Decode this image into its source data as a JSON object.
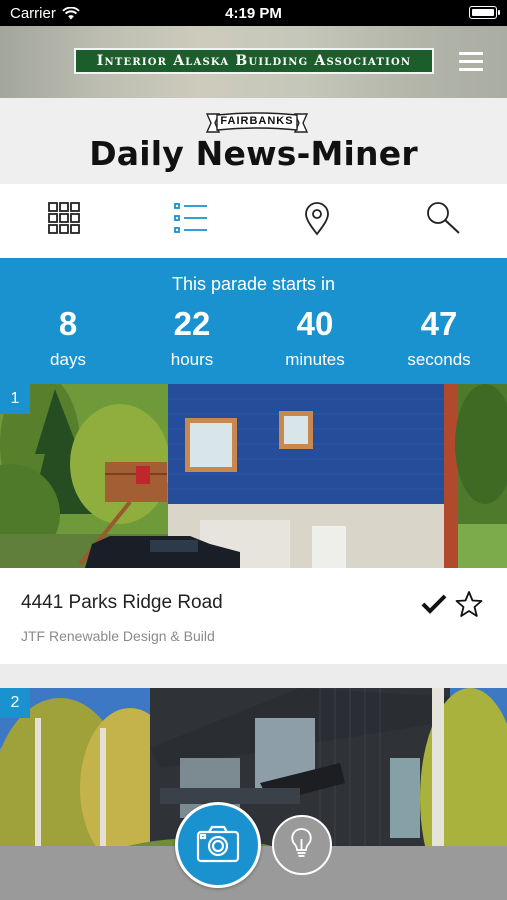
{
  "status_bar": {
    "carrier": "Carrier",
    "time": "4:19 PM"
  },
  "sponsor": {
    "name": "Interior Alaska Building Association",
    "menu_icon": "hamburger-menu-icon"
  },
  "masthead": {
    "ribbon": "FAIRBANKS",
    "title": "Daily News-Miner"
  },
  "toolbar": {
    "items": [
      {
        "icon": "grid-view-icon",
        "active": false
      },
      {
        "icon": "list-view-icon",
        "active": true
      },
      {
        "icon": "map-pin-icon",
        "active": false
      },
      {
        "icon": "search-icon",
        "active": false
      }
    ]
  },
  "countdown": {
    "heading": "This parade starts in",
    "units": [
      {
        "value": "8",
        "label": "days"
      },
      {
        "value": "22",
        "label": "hours"
      },
      {
        "value": "40",
        "label": "minutes"
      },
      {
        "value": "47",
        "label": "seconds"
      }
    ]
  },
  "listings": [
    {
      "number": "1",
      "address": "4441 Parks Ridge Road",
      "builder": "JTF Renewable Design & Build",
      "visited": true,
      "favorite": false
    },
    {
      "number": "2"
    }
  ],
  "bottom_bar": {
    "camera_icon": "camera-icon",
    "tip_icon": "lightbulb-icon"
  },
  "colors": {
    "accent": "#1a92cf",
    "sponsor_green": "#1b5e2b"
  }
}
